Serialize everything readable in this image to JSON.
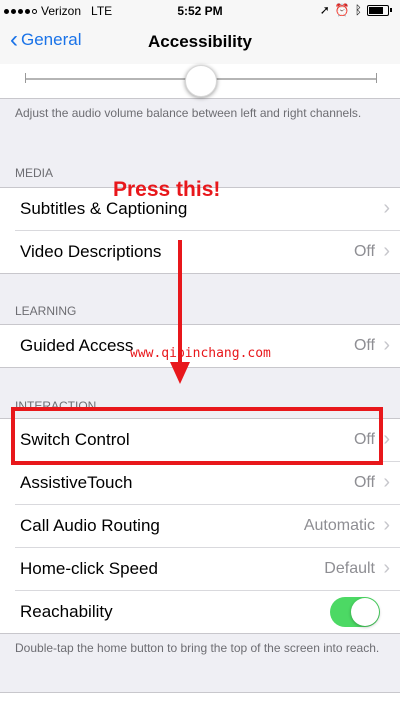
{
  "status_bar": {
    "carrier": "Verizon",
    "network": "LTE",
    "time": "5:52 PM"
  },
  "nav": {
    "back_label": "General",
    "title": "Accessibility"
  },
  "audio_balance": {
    "level": 0.5,
    "footer": "Adjust the audio volume balance between left and right channels."
  },
  "media": {
    "header": "MEDIA",
    "items": [
      {
        "label": "Subtitles & Captioning",
        "value": ""
      },
      {
        "label": "Video Descriptions",
        "value": "Off"
      }
    ]
  },
  "learning": {
    "header": "LEARNING",
    "items": [
      {
        "label": "Guided Access",
        "value": "Off"
      }
    ]
  },
  "interaction": {
    "header": "INTERACTION",
    "items": [
      {
        "label": "Switch Control",
        "value": "Off"
      },
      {
        "label": "AssistiveTouch",
        "value": "Off"
      },
      {
        "label": "Call Audio Routing",
        "value": "Automatic"
      },
      {
        "label": "Home-click Speed",
        "value": "Default"
      },
      {
        "label": "Reachability",
        "value": "",
        "toggle": true
      }
    ],
    "footer": "Double-tap the home button to bring the top of the screen into reach."
  },
  "annotation": {
    "text": "Press this!",
    "watermark": "www.qipinchang.com",
    "color": "#e8171b"
  },
  "colors": {
    "accent": "#1a73e8",
    "toggle_on": "#4cd964"
  }
}
